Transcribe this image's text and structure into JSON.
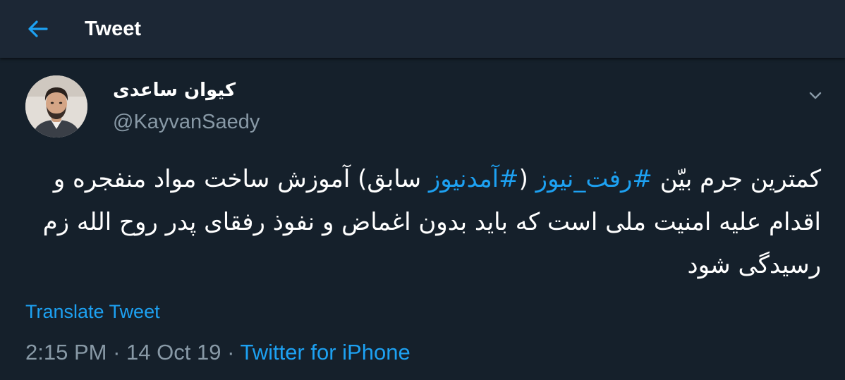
{
  "header": {
    "title": "Tweet",
    "back_icon": "arrow-left-icon",
    "accent": "#1da1f2"
  },
  "tweet": {
    "author": {
      "display_name": "کیوان ساعدی",
      "handle": "@KayvanSaedy",
      "avatar_icon": "avatar-photo"
    },
    "menu_icon": "chevron-down-icon",
    "text_parts": [
      "کمترین جرم بیّن ",
      "#رفت_نیوز",
      " (",
      "#آمدنیوز",
      " سابق) آموزش ساخت مواد منفجره و اقدام علیه امنیت ملی است که باید بدون اغماض و نفوذ رفقای پدر روح الله زم رسیدگی شود"
    ],
    "translate_label": "Translate Tweet",
    "time": "2:15 PM",
    "separator": "·",
    "date": "14 Oct 19",
    "source": "Twitter for iPhone"
  },
  "colors": {
    "background": "#15202b",
    "header_background": "#1c2735",
    "secondary_text": "#8899a6",
    "link": "#1da1f2"
  }
}
